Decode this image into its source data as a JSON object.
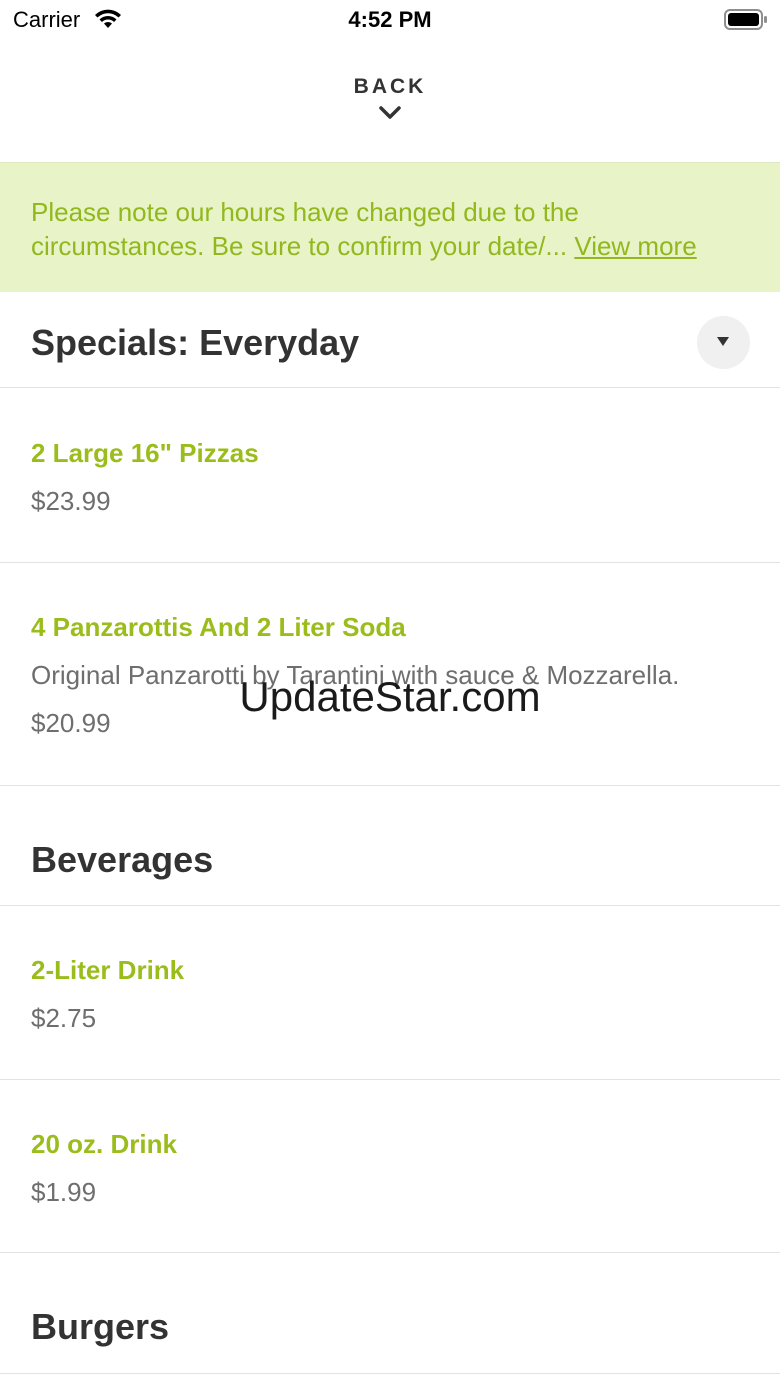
{
  "status_bar": {
    "carrier": "Carrier",
    "time": "4:52 PM"
  },
  "nav": {
    "back_label": "BACK"
  },
  "notice": {
    "text": "Please note our hours have changed due to the circumstances. Be sure to confirm your date/... ",
    "link": "View more",
    "background_color": "#e8f3c7",
    "text_color": "#92b81e"
  },
  "sections": [
    {
      "title": "Specials: Everyday",
      "items": [
        {
          "name": "2 Large 16\" Pizzas",
          "price": "$23.99"
        },
        {
          "name": "4 Panzarottis And 2 Liter Soda",
          "description": "Original Panzarotti by Tarantini with sauce & Mozzarella.",
          "price": "$20.99"
        }
      ]
    },
    {
      "title": "Beverages",
      "items": [
        {
          "name": "2-Liter Drink",
          "price": "$2.75"
        },
        {
          "name": "20 oz. Drink",
          "price": "$1.99"
        }
      ]
    },
    {
      "title": "Burgers",
      "items": []
    }
  ],
  "watermark": "UpdateStar.com",
  "colors": {
    "accent": "#9bbd1c",
    "heading": "#333333",
    "muted": "#6e6e6e",
    "divider": "#e3e3e3"
  },
  "icons": [
    "wifi-icon",
    "battery-icon",
    "chevron-down-icon",
    "caret-down-icon"
  ]
}
